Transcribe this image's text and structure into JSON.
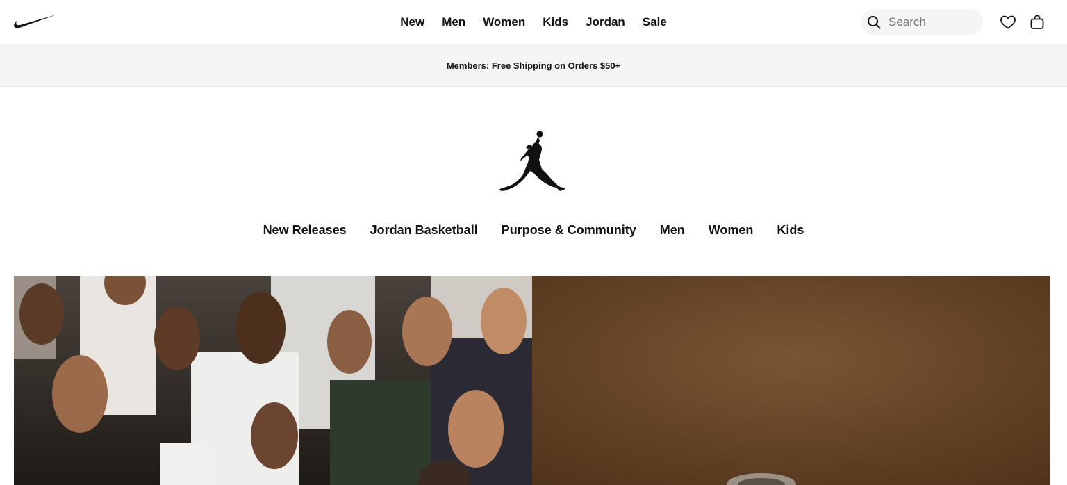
{
  "header": {
    "logo": "nike-swoosh",
    "nav": [
      "New",
      "Men",
      "Women",
      "Kids",
      "Jordan",
      "Sale"
    ],
    "search_placeholder": "Search",
    "icons": [
      "search-icon",
      "heart-icon",
      "bag-icon"
    ]
  },
  "banner": {
    "text": "Members: Free Shipping on Orders $50+"
  },
  "jordan": {
    "logo": "jumpman-logo",
    "nav": [
      "New Releases",
      "Jordan Basketball",
      "Purpose & Community",
      "Men",
      "Women",
      "Kids"
    ]
  },
  "colors": {
    "banner_bg": "#f5f5f5",
    "text": "#111111",
    "search_bg": "#f5f5f5",
    "hero_right_bg": "#6c4a2a"
  }
}
